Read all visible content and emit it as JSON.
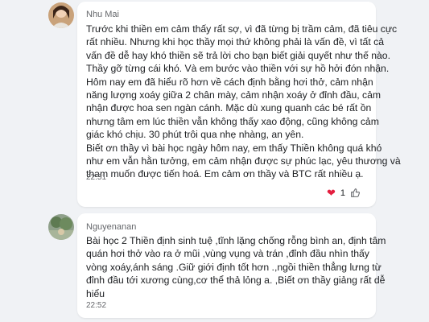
{
  "comments": [
    {
      "author": "Nhu Mai",
      "lines": [
        "Trước khi thiền em cảm thấy rất sợ, vì đã từng bị trầm cảm, đã tiêu cực",
        "rất nhiều. Nhưng khi học thầy mọi thứ không phải là vấn đề, vì tất cả",
        "vấn đề dễ hay khó thiền sẽ trả lời cho bạn biết giải quyết như thế nào.",
        "Thầy gỡ từng cái khó. Và em bước vào thiền với sự hồ hởi đón nhận.",
        "Hôm nay em đã hiểu rõ hơn về cách định bằng hơi thở, cảm nhận",
        "năng lượng xoáy giữa 2 chân mày, cảm nhận xoáy ở đỉnh đầu, cảm",
        "nhận được hoa sen ngàn cánh. Mặc dù xung quanh các bé rất ồn",
        "nhưng tâm em lúc thiền vẫn không thấy xao động, cũng không cảm",
        "giác khó chịu. 30 phút trôi qua nhẹ nhàng, an yên.",
        "Biết ơn thầy vì bài học ngày hôm nay, em thấy Thiền không quá khó",
        "như em vẫn hằn tưởng, em cảm nhận được sự phúc lạc, yêu thương và",
        "tham muốn được tiến hoá. Em cảm ơn thầy và BTC rất nhiều ạ."
      ],
      "time": "22:51",
      "reaction_count": "1"
    },
    {
      "author": "Nguyenanan",
      "lines": [
        "Bài học 2 Thiền định sinh tuệ ,tĩnh lặng chống rỗng bình an, định tâm",
        "quán hơi thở vào ra   ở mũi ,vùng vụng  và trán ,đỉnh đầu nhìn thấy",
        "vòng  xoáy,ánh sáng .Giữ giới định tốt hơn .,ngồi thiền thẳng lưng  từ",
        "đỉnh đầu tới  xương cùng,cơ thể thả lỏng a. ,Biết ơn thầy giảng rất dễ",
        "hiểu"
      ],
      "time": "22:52"
    }
  ],
  "colors": {
    "background": "#f0f2f5",
    "card": "#ffffff",
    "heart": "#e41e3f",
    "meta_text": "#65676b"
  },
  "icons": [
    "heart-icon",
    "thumbs-up-icon"
  ]
}
